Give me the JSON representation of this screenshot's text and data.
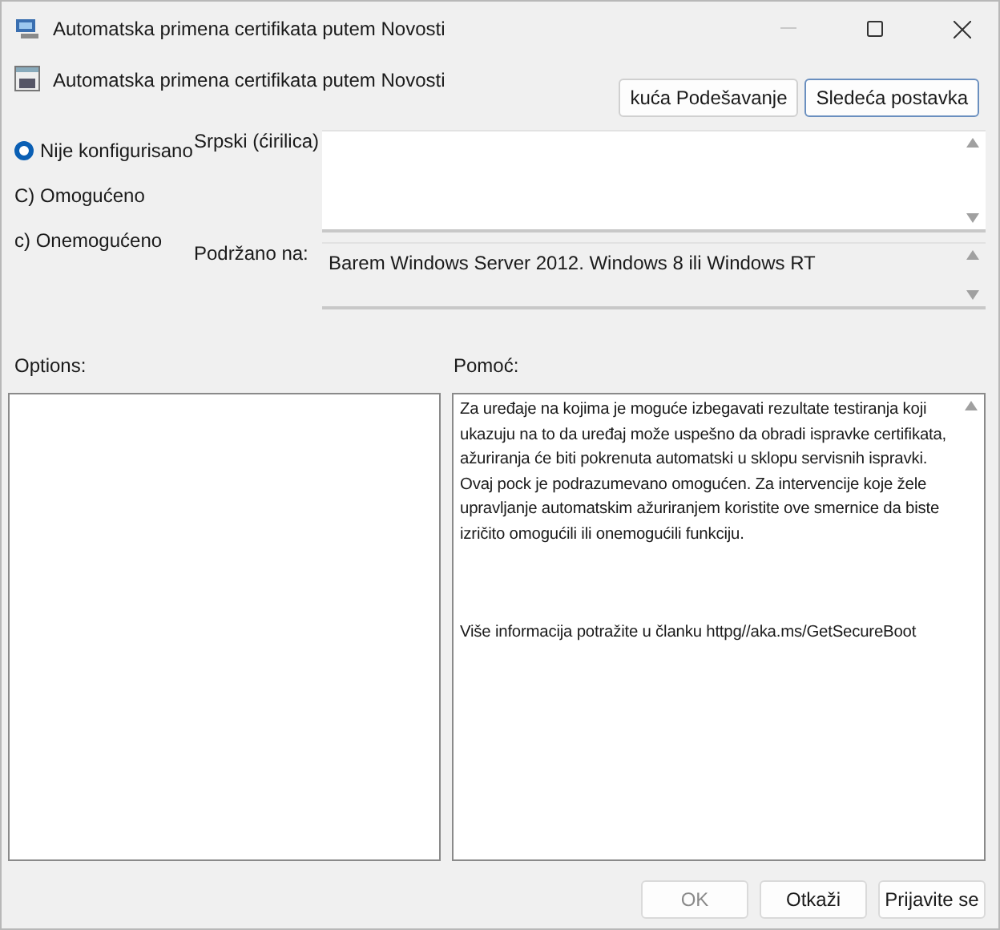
{
  "window": {
    "title": "Automatska primena certifikata putem Novosti"
  },
  "header": {
    "title": "Automatska primena certifikata putem Novosti",
    "buttons": [
      {
        "label": "kuća Podešavanje",
        "focused": false
      },
      {
        "label": "Sledeća postavka",
        "focused": true
      }
    ]
  },
  "options_state": [
    {
      "label": "Nije konfigurisano",
      "selected": true
    },
    {
      "label": "C) Omogućeno",
      "selected": false
    },
    {
      "label": "c) Onemogućeno",
      "selected": false
    }
  ],
  "comment": {
    "label": "Srpski (ćirilica)"
  },
  "supported": {
    "label": "Podržano na:",
    "value": "Barem Windows Server 2012. Windows 8 ili Windows RT"
  },
  "options_label": "Options:",
  "help": {
    "label": "Pomoć:",
    "paragraphs": [
      "Za uređaje na kojima je moguće izbegavati rezultate testiranja koji ukazuju na to da uređaj može uspešno da obradi ispravke certifikata, ažuriranja će biti pokrenuta automatski u sklopu servisnih ispravki. Ovaj pock je podrazumevano omogućen. Za intervencije koje žele upravljanje automatskim ažuriranjem koristite ove smernice da biste izričito omogućili ili onemogućili funkciju.",
      "Više informacija potražite u članku httpg//aka.ms/GetSecureBoot"
    ]
  },
  "footer_buttons": [
    {
      "label": "OK",
      "disabled": true
    },
    {
      "label": "Otkaži",
      "disabled": false
    },
    {
      "label": "Prijavite se",
      "disabled": false
    }
  ]
}
